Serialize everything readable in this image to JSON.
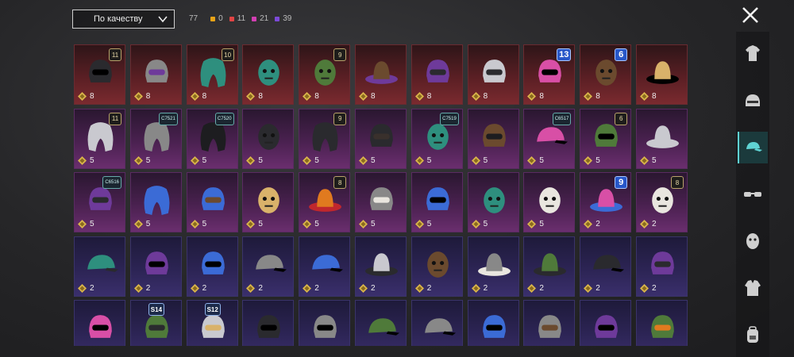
{
  "header": {
    "sort_label": "По качеству",
    "total_count": "77",
    "quality_counts": [
      {
        "value": "0",
        "color": "#e8a317"
      },
      {
        "value": "11",
        "color": "#e14444"
      },
      {
        "value": "21",
        "color": "#d23fb2"
      },
      {
        "value": "39",
        "color": "#7c4ad8"
      }
    ]
  },
  "rows": [
    {
      "quality": "red",
      "items": [
        {
          "icon": "black-helmet-icon",
          "qty": "8",
          "badge": "11",
          "badge_type": "level"
        },
        {
          "icon": "ghost-hood-icon",
          "qty": "8",
          "badge": "",
          "badge_type": ""
        },
        {
          "icon": "brown-hair-icon",
          "qty": "8",
          "badge": "10",
          "badge_type": "level"
        },
        {
          "icon": "blonde-skull-icon",
          "qty": "8",
          "badge": "",
          "badge_type": ""
        },
        {
          "icon": "zombie-head-icon",
          "qty": "8",
          "badge": "9",
          "badge_type": "level"
        },
        {
          "icon": "white-cowboy-hat-icon",
          "qty": "8",
          "badge": "",
          "badge_type": ""
        },
        {
          "icon": "red-helmet-icon",
          "qty": "8",
          "badge": "",
          "badge_type": ""
        },
        {
          "icon": "feather-mask-icon",
          "qty": "8",
          "badge": "",
          "badge_type": ""
        },
        {
          "icon": "robot-helmet-icon",
          "qty": "8",
          "badge": "13",
          "badge_type": "blue"
        },
        {
          "icon": "pink-box-head-icon",
          "qty": "8",
          "badge": "6",
          "badge_type": "blue"
        },
        {
          "icon": "black-hat-icon",
          "qty": "8",
          "badge": "",
          "badge_type": ""
        }
      ]
    },
    {
      "quality": "purple",
      "items": [
        {
          "icon": "flower-veil-icon",
          "qty": "5",
          "badge": "11",
          "badge_type": "level"
        },
        {
          "icon": "silver-hair-icon",
          "qty": "5",
          "badge": "C7521",
          "badge_type": "code"
        },
        {
          "icon": "green-hair-icon",
          "qty": "5",
          "badge": "C7520",
          "badge_type": "code"
        },
        {
          "icon": "pumpkin-head-icon",
          "qty": "5",
          "badge": "",
          "badge_type": ""
        },
        {
          "icon": "dark-hair-icon",
          "qty": "5",
          "badge": "9",
          "badge_type": "level"
        },
        {
          "icon": "white-helmet-icon",
          "qty": "5",
          "badge": "",
          "badge_type": ""
        },
        {
          "icon": "tribal-headdress-icon",
          "qty": "5",
          "badge": "C7519",
          "badge_type": "code"
        },
        {
          "icon": "dark-armor-helmet-icon",
          "qty": "5",
          "badge": "",
          "badge_type": ""
        },
        {
          "icon": "yellow-cap-icon",
          "qty": "5",
          "badge": "C6517",
          "badge_type": "code"
        },
        {
          "icon": "dark-knight-helmet-icon",
          "qty": "5",
          "badge": "6",
          "badge_type": "level"
        },
        {
          "icon": "red-top-hat-icon",
          "qty": "5",
          "badge": "",
          "badge_type": ""
        }
      ]
    },
    {
      "quality": "purple",
      "items": [
        {
          "icon": "red-hood-icon",
          "qty": "5",
          "badge": "C6516",
          "badge_type": "code"
        },
        {
          "icon": "blonde-curls-icon",
          "qty": "5",
          "badge": "",
          "badge_type": ""
        },
        {
          "icon": "cyber-mask-icon",
          "qty": "5",
          "badge": "",
          "badge_type": ""
        },
        {
          "icon": "tv-head-icon",
          "qty": "5",
          "badge": "",
          "badge_type": ""
        },
        {
          "icon": "steampunk-hat-icon",
          "qty": "5",
          "badge": "8",
          "badge_type": "level"
        },
        {
          "icon": "santa-rooster-icon",
          "qty": "5",
          "badge": "",
          "badge_type": ""
        },
        {
          "icon": "wooden-mask-icon",
          "qty": "5",
          "badge": "",
          "badge_type": ""
        },
        {
          "icon": "green-creature-icon",
          "qty": "5",
          "badge": "",
          "badge_type": ""
        },
        {
          "icon": "frankenstein-head-icon",
          "qty": "5",
          "badge": "",
          "badge_type": ""
        },
        {
          "icon": "straw-hat-icon",
          "qty": "2",
          "badge": "9",
          "badge_type": "blue"
        },
        {
          "icon": "green-skull-icon",
          "qty": "2",
          "badge": "8",
          "badge_type": "level"
        }
      ]
    },
    {
      "quality": "blue",
      "items": [
        {
          "icon": "blue-cap-icon",
          "qty": "2",
          "badge": "",
          "badge_type": ""
        },
        {
          "icon": "gas-mask-icon",
          "qty": "2",
          "badge": "",
          "badge_type": ""
        },
        {
          "icon": "purple-helmet-icon",
          "qty": "2",
          "badge": "",
          "badge_type": ""
        },
        {
          "icon": "black-cap-icon",
          "qty": "2",
          "badge": "",
          "badge_type": ""
        },
        {
          "icon": "navy-cap-icon",
          "qty": "2",
          "badge": "",
          "badge_type": ""
        },
        {
          "icon": "witch-hat-icon",
          "qty": "2",
          "badge": "",
          "badge_type": ""
        },
        {
          "icon": "headband-icon",
          "qty": "2",
          "badge": "",
          "badge_type": ""
        },
        {
          "icon": "goggles-hat-icon",
          "qty": "2",
          "badge": "",
          "badge_type": ""
        },
        {
          "icon": "purple-top-hat-icon",
          "qty": "2",
          "badge": "",
          "badge_type": ""
        },
        {
          "icon": "grey-cap-icon",
          "qty": "2",
          "badge": "",
          "badge_type": ""
        },
        {
          "icon": "fedora-icon",
          "qty": "2",
          "badge": "",
          "badge_type": ""
        }
      ]
    },
    {
      "quality": "blue",
      "items": [
        {
          "icon": "tribal-mask-icon",
          "qty": "",
          "badge": "",
          "badge_type": ""
        },
        {
          "icon": "gladiator-helmet-icon",
          "qty": "",
          "badge": "S14",
          "badge_type": "season"
        },
        {
          "icon": "motorcycle-helmet-icon",
          "qty": "",
          "badge": "S12",
          "badge_type": "season"
        },
        {
          "icon": "bunny-ears-icon",
          "qty": "",
          "badge": "",
          "badge_type": ""
        },
        {
          "icon": "pink-beret-icon",
          "qty": "",
          "badge": "",
          "badge_type": ""
        },
        {
          "icon": "aviator-cap-icon",
          "qty": "",
          "badge": "",
          "badge_type": ""
        },
        {
          "icon": "dark-cap-icon",
          "qty": "",
          "badge": "",
          "badge_type": ""
        },
        {
          "icon": "beanie-icon",
          "qty": "",
          "badge": "",
          "badge_type": ""
        },
        {
          "icon": "football-helmet-icon",
          "qty": "",
          "badge": "",
          "badge_type": ""
        },
        {
          "icon": "antler-band-icon",
          "qty": "",
          "badge": "",
          "badge_type": ""
        },
        {
          "icon": "ninja-mask-icon",
          "qty": "",
          "badge": "",
          "badge_type": ""
        }
      ]
    }
  ],
  "sidebar": {
    "items": [
      {
        "icon": "outfit-icon",
        "active": false
      },
      {
        "icon": "helmet-icon",
        "active": false
      },
      {
        "icon": "cap-icon",
        "active": true
      },
      {
        "icon": "glasses-icon",
        "active": false
      },
      {
        "icon": "mask-icon",
        "active": false
      },
      {
        "icon": "jacket-icon",
        "active": false
      },
      {
        "icon": "backpack-icon",
        "active": false
      }
    ]
  },
  "colors": {
    "accent": "#5fd3d3",
    "coin": "#d9b54a"
  }
}
